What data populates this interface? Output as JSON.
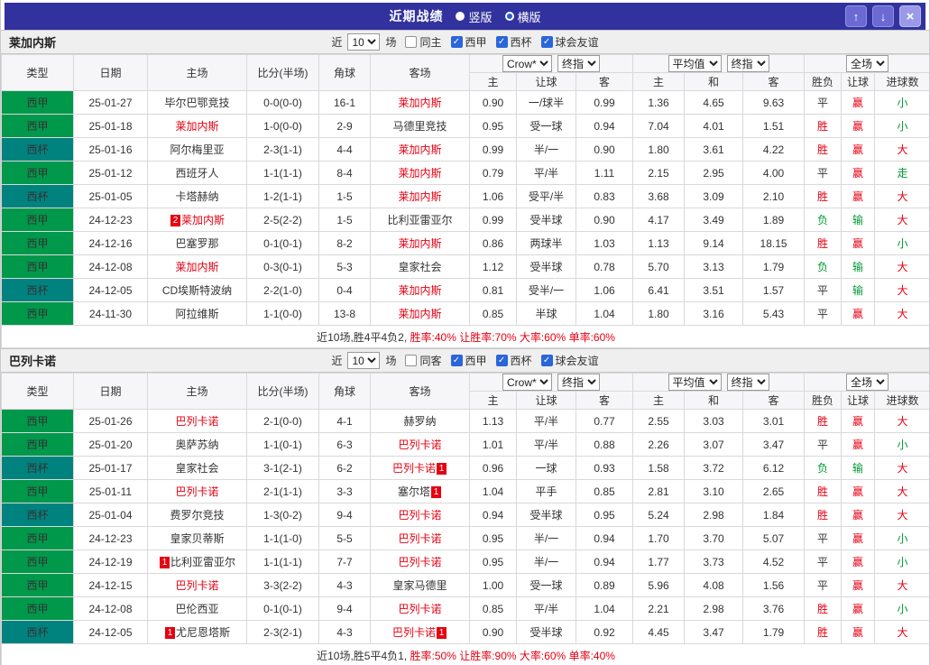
{
  "titlebar": {
    "title": "近期战绩",
    "vertical_label": "竖版",
    "horizontal_label": "横版",
    "selected_layout": "横版",
    "up_icon": "↑",
    "down_icon": "↓",
    "close_icon": "×",
    "bar_color": "#32329e"
  },
  "filters": {
    "near_label": "近",
    "count": "10",
    "matches_label": "场",
    "leagues": [
      {
        "label": "西甲",
        "checked": true
      },
      {
        "label": "西杯",
        "checked": true
      },
      {
        "label": "球会友谊",
        "checked": true
      }
    ]
  },
  "dropdowns": {
    "company": "Crow*",
    "asia_final": "终指",
    "average": "平均值",
    "eu_final": "终指",
    "scope": "全场"
  },
  "columns": {
    "main": [
      "类型",
      "日期",
      "主场",
      "比分(半场)",
      "角球",
      "客场"
    ],
    "sub": [
      "主",
      "让球",
      "客",
      "主",
      "和",
      "客",
      "胜负",
      "让球",
      "进球数"
    ]
  },
  "league_colors": {
    "西甲": "#00984b",
    "西杯": "#00837f"
  },
  "result_colors": {
    "胜": "#e60012",
    "平": "#333333",
    "负": "#009933",
    "赢": "#e60012",
    "输": "#009933",
    "大": "#e60012",
    "小": "#009933",
    "走": "#009933"
  },
  "team_highlight_color": "#e60012",
  "sections": [
    {
      "team": "莱加内斯",
      "same_label": "同主",
      "rows": [
        {
          "lg": "西甲",
          "date": "25-01-27",
          "home": {
            "name": "毕尔巴鄂竞技"
          },
          "score": "0-0(0-0)",
          "corner": "16-1",
          "away": {
            "name": "莱加内斯",
            "hl": true
          },
          "ah": [
            "0.90",
            "一/球半",
            "0.99"
          ],
          "eu": [
            "1.36",
            "4.65",
            "9.63"
          ],
          "res": [
            "平",
            "赢",
            "小"
          ]
        },
        {
          "lg": "西甲",
          "date": "25-01-18",
          "home": {
            "name": "莱加内斯",
            "hl": true
          },
          "score": "1-0(0-0)",
          "corner": "2-9",
          "away": {
            "name": "马德里竞技"
          },
          "ah": [
            "0.95",
            "受一球",
            "0.94"
          ],
          "eu": [
            "7.04",
            "4.01",
            "1.51"
          ],
          "res": [
            "胜",
            "赢",
            "小"
          ]
        },
        {
          "lg": "西杯",
          "date": "25-01-16",
          "home": {
            "name": "阿尔梅里亚"
          },
          "score": "2-3(1-1)",
          "corner": "4-4",
          "away": {
            "name": "莱加内斯",
            "hl": true
          },
          "ah": [
            "0.99",
            "半/一",
            "0.90"
          ],
          "eu": [
            "1.80",
            "3.61",
            "4.22"
          ],
          "res": [
            "胜",
            "赢",
            "大"
          ]
        },
        {
          "lg": "西甲",
          "date": "25-01-12",
          "home": {
            "name": "西班牙人"
          },
          "score": "1-1(1-1)",
          "corner": "8-4",
          "away": {
            "name": "莱加内斯",
            "hl": true
          },
          "ah": [
            "0.79",
            "平/半",
            "1.11"
          ],
          "eu": [
            "2.15",
            "2.95",
            "4.00"
          ],
          "res": [
            "平",
            "赢",
            "走"
          ]
        },
        {
          "lg": "西杯",
          "date": "25-01-05",
          "home": {
            "name": "卡塔赫纳"
          },
          "score": "1-2(1-1)",
          "corner": "1-5",
          "away": {
            "name": "莱加内斯",
            "hl": true
          },
          "ah": [
            "1.06",
            "受平/半",
            "0.83"
          ],
          "eu": [
            "3.68",
            "3.09",
            "2.10"
          ],
          "res": [
            "胜",
            "赢",
            "大"
          ]
        },
        {
          "lg": "西甲",
          "date": "24-12-23",
          "home": {
            "name": "莱加内斯",
            "hl": true,
            "pre_badge": "2"
          },
          "score": "2-5(2-2)",
          "corner": "1-5",
          "away": {
            "name": "比利亚雷亚尔"
          },
          "ah": [
            "0.99",
            "受半球",
            "0.90"
          ],
          "eu": [
            "4.17",
            "3.49",
            "1.89"
          ],
          "res": [
            "负",
            "输",
            "大"
          ]
        },
        {
          "lg": "西甲",
          "date": "24-12-16",
          "home": {
            "name": "巴塞罗那"
          },
          "score": "0-1(0-1)",
          "corner": "8-2",
          "away": {
            "name": "莱加内斯",
            "hl": true
          },
          "ah": [
            "0.86",
            "两球半",
            "1.03"
          ],
          "eu": [
            "1.13",
            "9.14",
            "18.15"
          ],
          "res": [
            "胜",
            "赢",
            "小"
          ]
        },
        {
          "lg": "西甲",
          "date": "24-12-08",
          "home": {
            "name": "莱加内斯",
            "hl": true
          },
          "score": "0-3(0-1)",
          "corner": "5-3",
          "away": {
            "name": "皇家社会"
          },
          "ah": [
            "1.12",
            "受半球",
            "0.78"
          ],
          "eu": [
            "5.70",
            "3.13",
            "1.79"
          ],
          "res": [
            "负",
            "输",
            "大"
          ]
        },
        {
          "lg": "西杯",
          "date": "24-12-05",
          "home": {
            "name": "CD埃斯特波纳"
          },
          "score": "2-2(1-0)",
          "corner": "0-4",
          "away": {
            "name": "莱加内斯",
            "hl": true
          },
          "ah": [
            "0.81",
            "受半/一",
            "1.06"
          ],
          "eu": [
            "6.41",
            "3.51",
            "1.57"
          ],
          "res": [
            "平",
            "输",
            "大"
          ]
        },
        {
          "lg": "西甲",
          "date": "24-11-30",
          "home": {
            "name": "阿拉维斯"
          },
          "score": "1-1(0-0)",
          "corner": "13-8",
          "away": {
            "name": "莱加内斯",
            "hl": true
          },
          "ah": [
            "0.85",
            "半球",
            "1.04"
          ],
          "eu": [
            "1.80",
            "3.16",
            "5.43"
          ],
          "res": [
            "平",
            "赢",
            "大"
          ]
        }
      ],
      "summary": {
        "prefix": "近10场,胜4平4负2,",
        "stats": "胜率:40% 让胜率:70% 大率:60% 单率:60%"
      }
    },
    {
      "team": "巴列卡诺",
      "same_label": "同客",
      "rows": [
        {
          "lg": "西甲",
          "date": "25-01-26",
          "home": {
            "name": "巴列卡诺",
            "hl": true
          },
          "score": "2-1(0-0)",
          "corner": "4-1",
          "away": {
            "name": "赫罗纳"
          },
          "ah": [
            "1.13",
            "平/半",
            "0.77"
          ],
          "eu": [
            "2.55",
            "3.03",
            "3.01"
          ],
          "res": [
            "胜",
            "赢",
            "大"
          ]
        },
        {
          "lg": "西甲",
          "date": "25-01-20",
          "home": {
            "name": "奥萨苏纳"
          },
          "score": "1-1(0-1)",
          "corner": "6-3",
          "away": {
            "name": "巴列卡诺",
            "hl": true
          },
          "ah": [
            "1.01",
            "平/半",
            "0.88"
          ],
          "eu": [
            "2.26",
            "3.07",
            "3.47"
          ],
          "res": [
            "平",
            "赢",
            "小"
          ]
        },
        {
          "lg": "西杯",
          "date": "25-01-17",
          "home": {
            "name": "皇家社会"
          },
          "score": "3-1(2-1)",
          "corner": "6-2",
          "away": {
            "name": "巴列卡诺",
            "hl": true,
            "post_badge": "1"
          },
          "ah": [
            "0.96",
            "一球",
            "0.93"
          ],
          "eu": [
            "1.58",
            "3.72",
            "6.12"
          ],
          "res": [
            "负",
            "输",
            "大"
          ]
        },
        {
          "lg": "西甲",
          "date": "25-01-11",
          "home": {
            "name": "巴列卡诺",
            "hl": true
          },
          "score": "2-1(1-1)",
          "corner": "3-3",
          "away": {
            "name": "塞尔塔",
            "post_badge": "1"
          },
          "ah": [
            "1.04",
            "平手",
            "0.85"
          ],
          "eu": [
            "2.81",
            "3.10",
            "2.65"
          ],
          "res": [
            "胜",
            "赢",
            "大"
          ]
        },
        {
          "lg": "西杯",
          "date": "25-01-04",
          "home": {
            "name": "费罗尔竞技"
          },
          "score": "1-3(0-2)",
          "corner": "9-4",
          "away": {
            "name": "巴列卡诺",
            "hl": true
          },
          "ah": [
            "0.94",
            "受半球",
            "0.95"
          ],
          "eu": [
            "5.24",
            "2.98",
            "1.84"
          ],
          "res": [
            "胜",
            "赢",
            "大"
          ]
        },
        {
          "lg": "西甲",
          "date": "24-12-23",
          "home": {
            "name": "皇家贝蒂斯"
          },
          "score": "1-1(1-0)",
          "corner": "5-5",
          "away": {
            "name": "巴列卡诺",
            "hl": true
          },
          "ah": [
            "0.95",
            "半/一",
            "0.94"
          ],
          "eu": [
            "1.70",
            "3.70",
            "5.07"
          ],
          "res": [
            "平",
            "赢",
            "小"
          ]
        },
        {
          "lg": "西甲",
          "date": "24-12-19",
          "home": {
            "name": "比利亚雷亚尔",
            "pre_badge": "1"
          },
          "score": "1-1(1-1)",
          "corner": "7-7",
          "away": {
            "name": "巴列卡诺",
            "hl": true
          },
          "ah": [
            "0.95",
            "半/一",
            "0.94"
          ],
          "eu": [
            "1.77",
            "3.73",
            "4.52"
          ],
          "res": [
            "平",
            "赢",
            "小"
          ]
        },
        {
          "lg": "西甲",
          "date": "24-12-15",
          "home": {
            "name": "巴列卡诺",
            "hl": true
          },
          "score": "3-3(2-2)",
          "corner": "4-3",
          "away": {
            "name": "皇家马德里"
          },
          "ah": [
            "1.00",
            "受一球",
            "0.89"
          ],
          "eu": [
            "5.96",
            "4.08",
            "1.56"
          ],
          "res": [
            "平",
            "赢",
            "大"
          ]
        },
        {
          "lg": "西甲",
          "date": "24-12-08",
          "home": {
            "name": "巴伦西亚"
          },
          "score": "0-1(0-1)",
          "corner": "9-4",
          "away": {
            "name": "巴列卡诺",
            "hl": true
          },
          "ah": [
            "0.85",
            "平/半",
            "1.04"
          ],
          "eu": [
            "2.21",
            "2.98",
            "3.76"
          ],
          "res": [
            "胜",
            "赢",
            "小"
          ]
        },
        {
          "lg": "西杯",
          "date": "24-12-05",
          "home": {
            "name": "尤尼恩塔斯",
            "pre_badge": "1"
          },
          "score": "2-3(2-1)",
          "corner": "4-3",
          "away": {
            "name": "巴列卡诺",
            "hl": true,
            "post_badge": "1"
          },
          "ah": [
            "0.90",
            "受半球",
            "0.92"
          ],
          "eu": [
            "4.45",
            "3.47",
            "1.79"
          ],
          "res": [
            "胜",
            "赢",
            "大"
          ]
        }
      ],
      "summary": {
        "prefix": "近10场,胜5平4负1,",
        "stats": "胜率:50% 让胜率:90% 大率:60% 单率:40%"
      }
    }
  ]
}
